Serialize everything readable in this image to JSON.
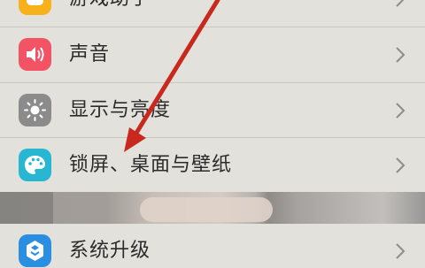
{
  "settings": {
    "items": [
      {
        "label": "游戏助手",
        "icon": "game-assistant-icon",
        "color": "#f7b21b"
      },
      {
        "label": "声音",
        "icon": "speaker-icon",
        "color": "#f25466"
      },
      {
        "label": "显示与亮度",
        "icon": "brightness-icon",
        "color": "#8b8b8b"
      },
      {
        "label": "锁屏、桌面与壁纸",
        "icon": "palette-icon",
        "color": "#27b7d3"
      },
      {
        "label": "系统升级",
        "icon": "system-update-icon",
        "color": "#2a8fe0"
      }
    ],
    "chevron": "chevron-right-icon",
    "annotation_color": "#c8281e"
  }
}
